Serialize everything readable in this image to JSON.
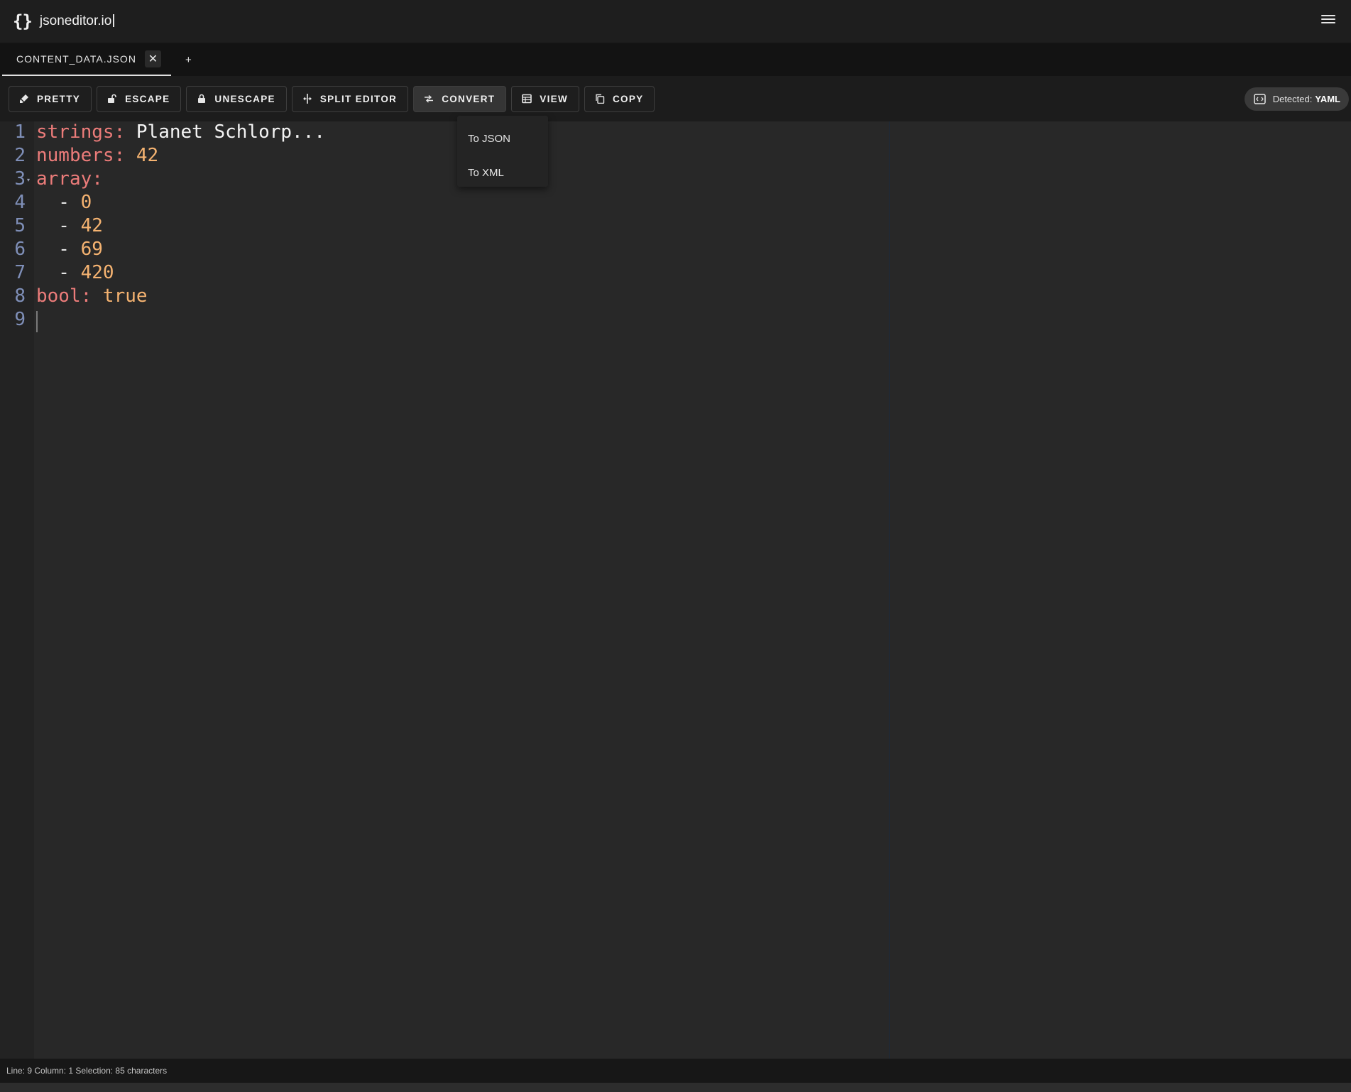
{
  "header": {
    "logo_glyph": "{}",
    "brand": "jsoneditor.io",
    "menu_icon": "hamburger-menu-icon"
  },
  "tabs": [
    {
      "title": "CONTENT_DATA.JSON",
      "close_glyph": "✕",
      "active": true
    }
  ],
  "tab_add_label": "+",
  "toolbar": {
    "buttons": [
      {
        "label": "PRETTY",
        "icon": "brush-icon"
      },
      {
        "label": "ESCAPE",
        "icon": "unlock-icon"
      },
      {
        "label": "UNESCAPE",
        "icon": "lock-icon"
      },
      {
        "label": "SPLIT EDITOR",
        "icon": "split-icon"
      },
      {
        "label": "CONVERT",
        "icon": "swap-arrows-icon",
        "active": true
      },
      {
        "label": "VIEW",
        "icon": "table-icon"
      },
      {
        "label": "COPY",
        "icon": "copy-icon"
      }
    ],
    "detected": {
      "label": "Detected:",
      "value": "YAML",
      "icon": "code-window-icon"
    }
  },
  "convert_menu": {
    "items": [
      "To JSON",
      "To XML"
    ]
  },
  "editor": {
    "line_numbers": [
      "1",
      "2",
      "3",
      "4",
      "5",
      "6",
      "7",
      "8",
      "9"
    ],
    "lines": [
      {
        "key": "strings:",
        "value": " Planet Schlorp..."
      },
      {
        "key": "numbers:",
        "value": " 42"
      },
      {
        "key": "array:",
        "value": ""
      },
      {
        "prefix": "  - ",
        "value": "0"
      },
      {
        "prefix": "  - ",
        "value": "42"
      },
      {
        "prefix": "  - ",
        "value": "69"
      },
      {
        "prefix": "  - ",
        "value": "420"
      },
      {
        "key": "bool:",
        "value": " true"
      }
    ],
    "fold_marker": "▾"
  },
  "status": "Line: 9 Column: 1 Selection: 85 characters",
  "colors": {
    "key": "#ec7c7a",
    "string": "#f4f4f4",
    "number": "#f5b371",
    "line_number": "#7f8fb8",
    "background": "#282828"
  }
}
